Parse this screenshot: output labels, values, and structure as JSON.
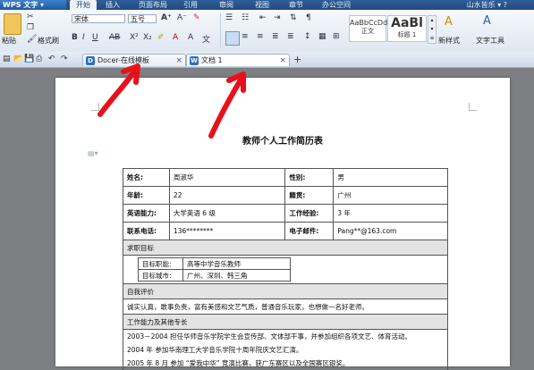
{
  "app": {
    "name": "WPS 文字",
    "menu_tabs": [
      "开始",
      "插入",
      "页面布局",
      "引用",
      "审阅",
      "视图",
      "章节",
      "办公空间"
    ],
    "active_tab": "开始",
    "user": "山水皆乐"
  },
  "ribbon": {
    "paste": "粘贴",
    "format_painter": "格式刷",
    "font_name": "宋体",
    "font_size": "五号",
    "styles": [
      {
        "preview": "AaBbCcDd",
        "name": "正文"
      },
      {
        "preview": "AaBl",
        "name": "标题 1"
      }
    ],
    "new_style": "新样式",
    "text_tools": "文字工具"
  },
  "doc_tabs": [
    {
      "label": "Docer-在线模板",
      "icon_color": "#2f6fc0",
      "icon_letter": "D"
    },
    {
      "label": "文档 1",
      "icon_color": "#2f6fc0",
      "icon_letter": "W"
    }
  ],
  "document": {
    "title": "教师个人工作简历表",
    "rows": [
      [
        "姓名:",
        "周淑华",
        "性别:",
        "男"
      ],
      [
        "年龄:",
        "22",
        "籍贯:",
        "广州"
      ],
      [
        "英语能力:",
        "大学英语 6 级",
        "工作经验:",
        "3 年"
      ],
      [
        "联系电话:",
        "136********",
        "电子邮件:",
        "Pang**@163.com"
      ]
    ],
    "section_goal": "求职目标",
    "goal_rows": [
      [
        "目标职能:",
        "高等中学音乐教师"
      ],
      [
        "目标城市:",
        "广州、深圳、韩三角"
      ]
    ],
    "section_self": "自我评价",
    "self_text": "诚实认真，敢事负责，富有美感和文艺气质，普通音乐玩家，也想做一名好老师。",
    "section_ability": "工作能力及其他专长",
    "ability_lines": [
      "2003－2004 担任华师音乐学院学生会宣传部、文体部干事，并参加组织各项文艺、体育活动。",
      "2004 年 参加华南理工大学音乐学院十周年院庆文艺汇演。",
      "2005 年 8 月 参加 “爱我中华” 竞演比赛，获广东赛区以及全国赛区银奖。"
    ]
  }
}
